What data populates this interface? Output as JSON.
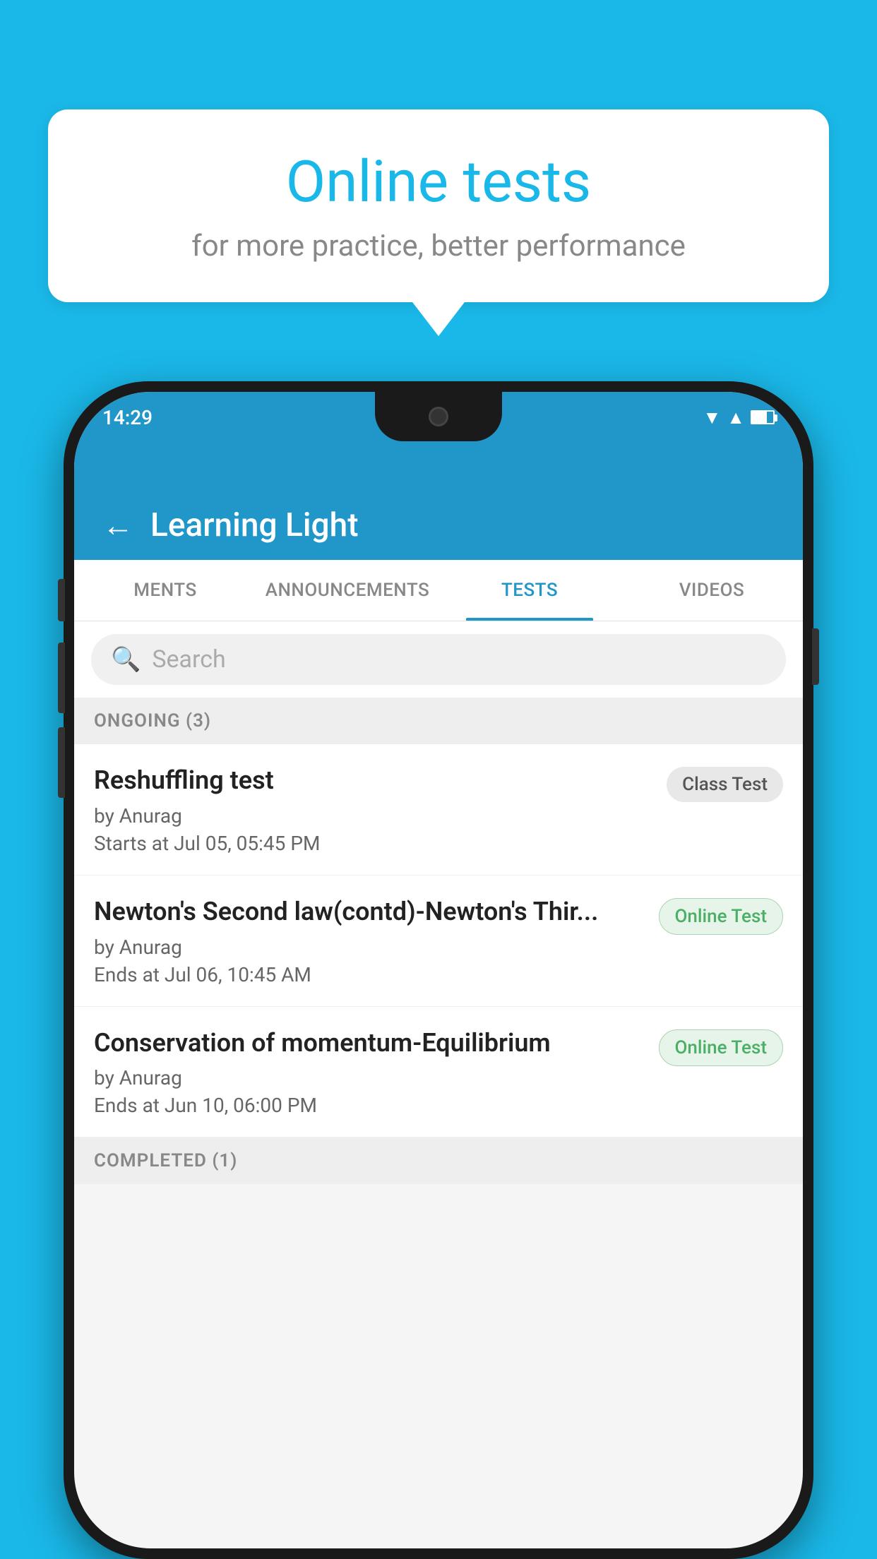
{
  "background_color": "#1ab8e8",
  "bubble": {
    "title": "Online tests",
    "subtitle": "for more practice, better performance"
  },
  "phone": {
    "status_bar": {
      "time": "14:29",
      "icons": [
        "wifi",
        "signal",
        "battery"
      ]
    },
    "app_name": "Learning Light",
    "tabs": [
      {
        "label": "MENTS",
        "active": false
      },
      {
        "label": "ANNOUNCEMENTS",
        "active": false
      },
      {
        "label": "TESTS",
        "active": true
      },
      {
        "label": "VIDEOS",
        "active": false
      }
    ],
    "search": {
      "placeholder": "Search"
    },
    "ongoing_section": {
      "label": "ONGOING (3)",
      "tests": [
        {
          "name": "Reshuffling test",
          "author": "by Anurag",
          "time_label": "Starts at",
          "time": "Jul 05, 05:45 PM",
          "badge": "Class Test",
          "badge_type": "class"
        },
        {
          "name": "Newton's Second law(contd)-Newton's Thir...",
          "author": "by Anurag",
          "time_label": "Ends at",
          "time": "Jul 06, 10:45 AM",
          "badge": "Online Test",
          "badge_type": "online"
        },
        {
          "name": "Conservation of momentum-Equilibrium",
          "author": "by Anurag",
          "time_label": "Ends at",
          "time": "Jun 10, 06:00 PM",
          "badge": "Online Test",
          "badge_type": "online"
        }
      ]
    },
    "completed_section": {
      "label": "COMPLETED (1)"
    }
  }
}
